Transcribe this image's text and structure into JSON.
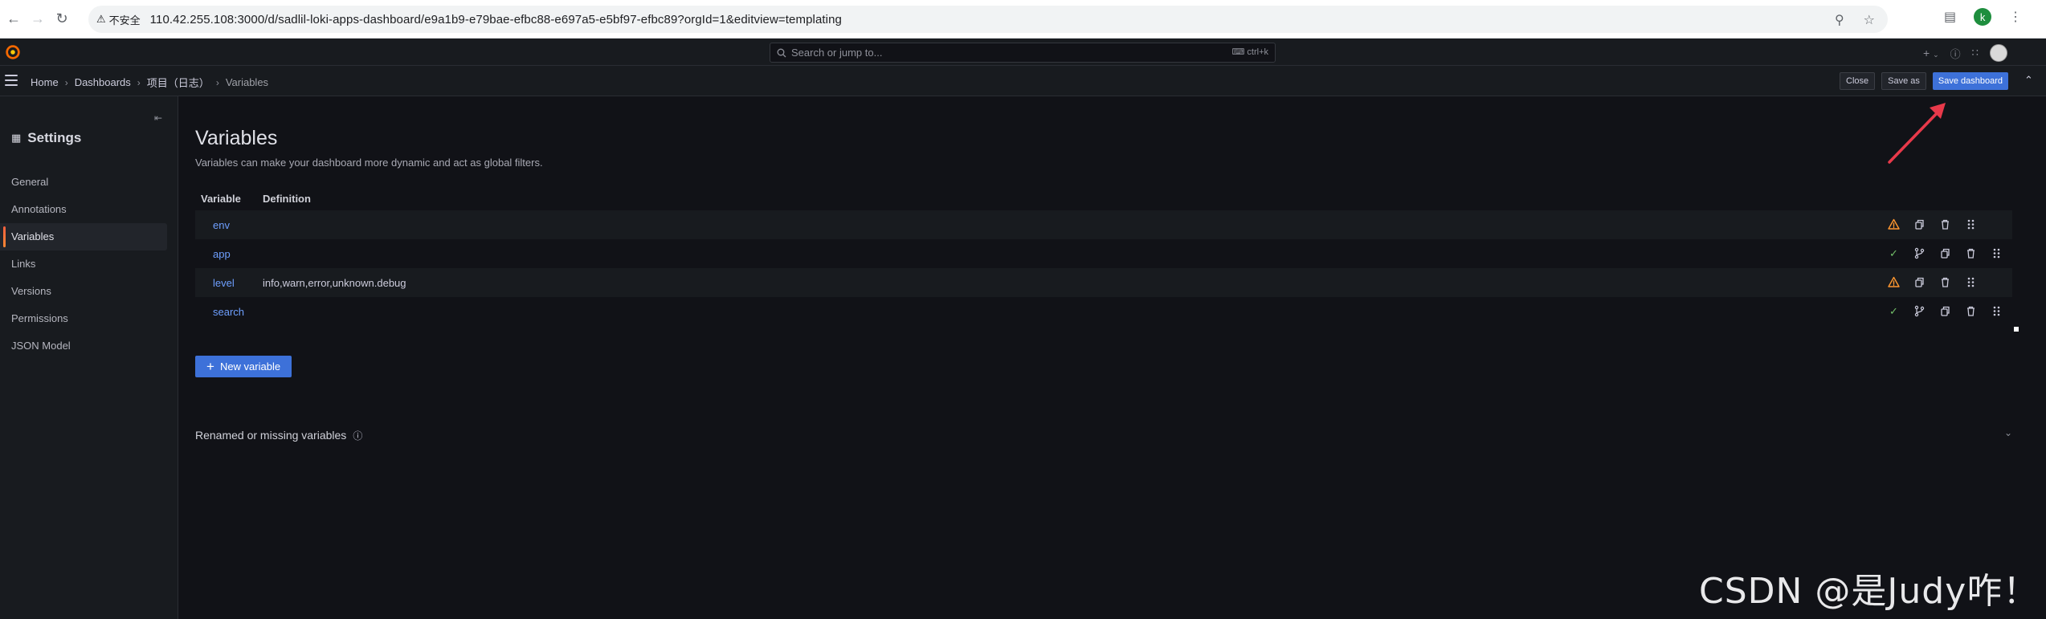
{
  "browser": {
    "insecure_label": "不安全",
    "url": "110.42.255.108:3000/d/sadlil-loki-apps-dashboard/e9a1b9-e79bae-efbc88-e697a5-e5bf97-efbc89?orgId=1&editview=templating",
    "profile_initial": "k"
  },
  "topbar": {
    "search_placeholder": "Search or jump to...",
    "search_shortcut": "ctrl+k",
    "plus_label": "+"
  },
  "breadcrumb": {
    "items": [
      "Home",
      "Dashboards",
      "项目（日志）",
      "Variables"
    ]
  },
  "actions": {
    "close_label": "Close",
    "save_as_label": "Save as",
    "save_dashboard_label": "Save dashboard"
  },
  "sidebar": {
    "title": "Settings",
    "items": [
      {
        "label": "General"
      },
      {
        "label": "Annotations"
      },
      {
        "label": "Variables"
      },
      {
        "label": "Links"
      },
      {
        "label": "Versions"
      },
      {
        "label": "Permissions"
      },
      {
        "label": "JSON Model"
      }
    ]
  },
  "main": {
    "title": "Variables",
    "subtitle": "Variables can make your dashboard more dynamic and act as global filters.",
    "columns": [
      "Variable",
      "Definition"
    ],
    "rows": [
      {
        "name": "env",
        "definition": "",
        "status": "warning"
      },
      {
        "name": "app",
        "definition": "",
        "status": "ok"
      },
      {
        "name": "level",
        "definition": "info,warn,error,unknown.debug",
        "status": "warning"
      },
      {
        "name": "search",
        "definition": "",
        "status": "ok"
      }
    ],
    "new_variable_label": "New variable",
    "renamed_label": "Renamed or missing variables"
  },
  "watermark": "CSDN @是Judy咋！",
  "colors": {
    "accent": "#3d71d9",
    "link": "#6e9fff",
    "warning": "#ff9830",
    "ok": "#73bf69",
    "annotation_arrow": "#e8394a"
  }
}
